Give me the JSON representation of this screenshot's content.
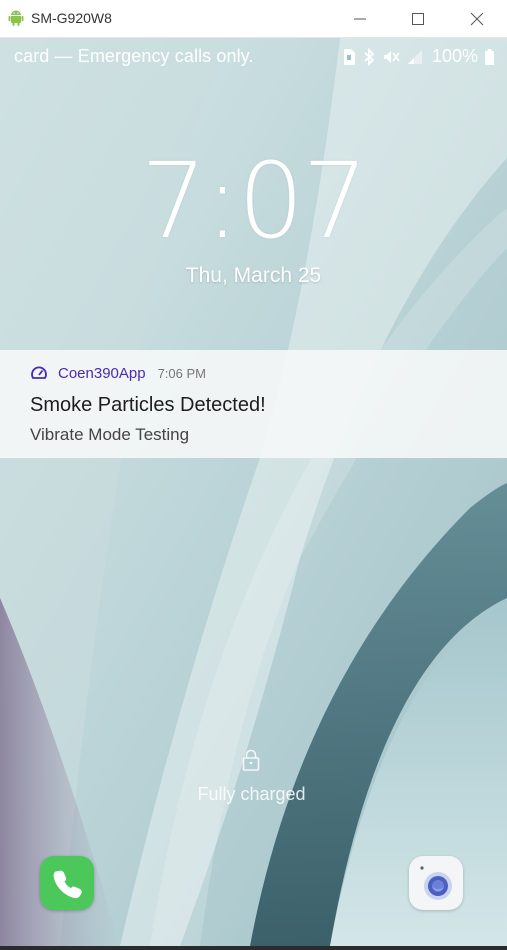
{
  "window": {
    "title": "SM-G920W8",
    "icon": "android-icon",
    "controls": [
      "minimize-icon",
      "maximize-icon",
      "close-icon"
    ]
  },
  "statusbar": {
    "carrier": "card — Emergency calls only.",
    "icons": [
      "sim-icon",
      "bluetooth-icon",
      "mute-icon",
      "signal-icon",
      "battery-icon"
    ],
    "battery": "100%"
  },
  "lockscreen": {
    "time": "7:07",
    "date": "Thu, March 25",
    "charge_status": "Fully charged"
  },
  "notification": {
    "app_icon": "speedometer-icon",
    "app_name": "Coen390App",
    "time": "7:06 PM",
    "title": "Smoke Particles Detected!",
    "body": "Vibrate Mode Testing",
    "accent_color": "#4a2bb5"
  },
  "shortcuts": {
    "left": "phone-icon",
    "right": "camera-icon"
  }
}
